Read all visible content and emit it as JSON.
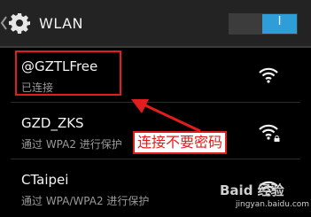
{
  "header": {
    "title": "WLAN",
    "toggle_label": "I",
    "accent_color": "#2f9ed8"
  },
  "networks": [
    {
      "ssid": "@GZTLFree",
      "status": "已连接",
      "secured": false
    },
    {
      "ssid": "GZD_ZKS",
      "status": "通过 WPA2 进行保护",
      "secured": true
    },
    {
      "ssid": "CTaipei",
      "status": "通过 WPA/WPA2 进行保护",
      "secured": true
    }
  ],
  "annotation": {
    "text": "连接不要密码",
    "color": "#e11d1d"
  },
  "watermark": {
    "logo": "Baid 经验",
    "url": "jingyan.baidu.com"
  },
  "icons": [
    "back-chevron-icon",
    "gear-icon",
    "wifi-signal-icon",
    "lock-icon"
  ]
}
